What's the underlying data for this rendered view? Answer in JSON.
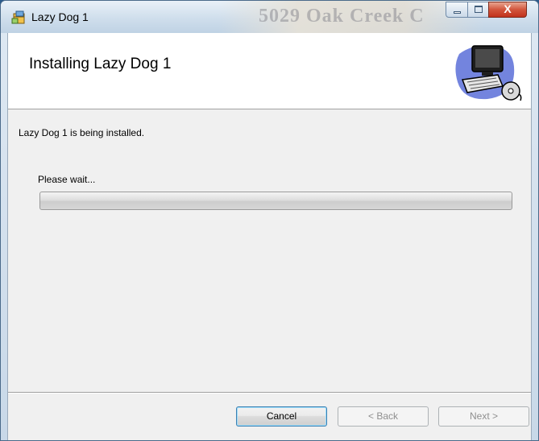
{
  "window": {
    "title": "Lazy Dog 1",
    "background_ghost_text": "5029 Oak Creek C"
  },
  "title_controls": {
    "minimize_icon": "minimize-icon",
    "maximize_icon": "maximize-icon",
    "close_glyph": "X"
  },
  "banner": {
    "title": "Installing Lazy Dog 1",
    "image_icon": "computer-setup-icon"
  },
  "body": {
    "status_text": "Lazy Dog 1 is being installed.",
    "wait_label": "Please wait...",
    "progress_percent": 0
  },
  "buttons": {
    "cancel": "Cancel",
    "back": "< Back",
    "next": "Next >"
  },
  "colors": {
    "close_button": "#c1321c",
    "dialog_bg": "#f0f0f0",
    "banner_bg": "#ffffff"
  }
}
